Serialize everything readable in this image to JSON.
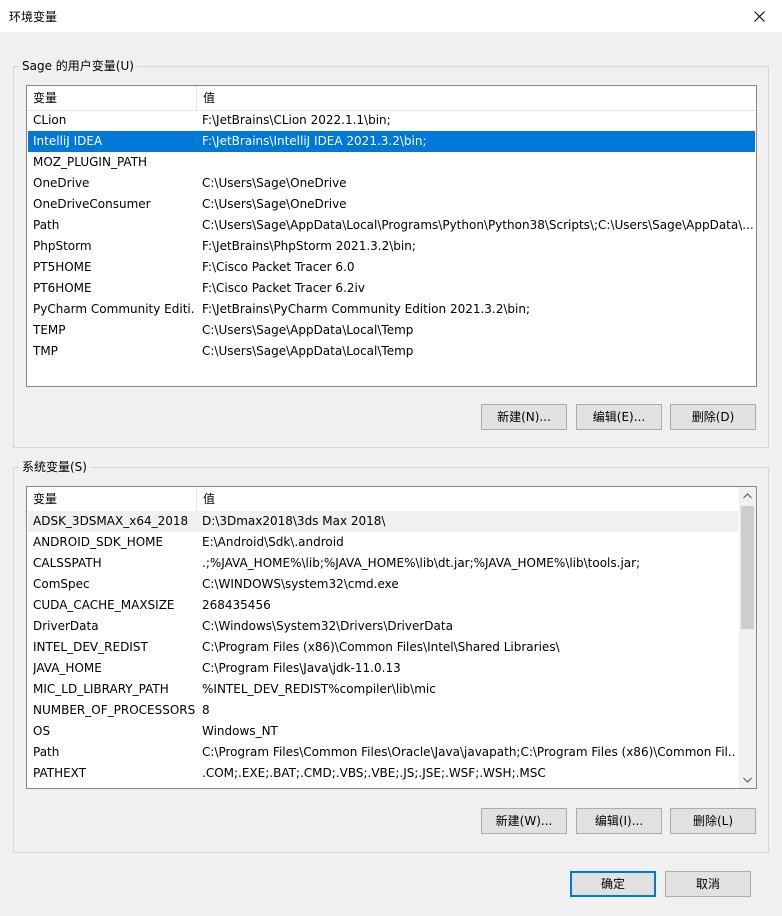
{
  "window": {
    "title": "环境变量",
    "close_icon": "close-icon"
  },
  "user_vars": {
    "group_label": "Sage 的用户变量(U)",
    "columns": [
      "变量",
      "值"
    ],
    "rows": [
      {
        "name": "CLion",
        "value": "F:\\JetBrains\\CLion 2022.1.1\\bin;"
      },
      {
        "name": "IntelliJ IDEA",
        "value": "F:\\JetBrains\\IntelliJ IDEA 2021.3.2\\bin;",
        "selected": true
      },
      {
        "name": "MOZ_PLUGIN_PATH",
        "value": ""
      },
      {
        "name": "OneDrive",
        "value": "C:\\Users\\Sage\\OneDrive"
      },
      {
        "name": "OneDriveConsumer",
        "value": "C:\\Users\\Sage\\OneDrive"
      },
      {
        "name": "Path",
        "value": "C:\\Users\\Sage\\AppData\\Local\\Programs\\Python\\Python38\\Scripts\\;C:\\Users\\Sage\\AppData\\..."
      },
      {
        "name": "PhpStorm",
        "value": "F:\\JetBrains\\PhpStorm 2021.3.2\\bin;"
      },
      {
        "name": "PT5HOME",
        "value": "F:\\Cisco Packet Tracer 6.0"
      },
      {
        "name": "PT6HOME",
        "value": "F:\\Cisco Packet Tracer 6.2iv"
      },
      {
        "name": "PyCharm Community Editi...",
        "value": "F:\\JetBrains\\PyCharm Community Edition 2021.3.2\\bin;"
      },
      {
        "name": "TEMP",
        "value": "C:\\Users\\Sage\\AppData\\Local\\Temp"
      },
      {
        "name": "TMP",
        "value": "C:\\Users\\Sage\\AppData\\Local\\Temp"
      }
    ],
    "buttons": {
      "new": "新建(N)...",
      "edit": "编辑(E)...",
      "delete": "删除(D)"
    }
  },
  "system_vars": {
    "group_label": "系统变量(S)",
    "columns": [
      "变量",
      "值"
    ],
    "rows": [
      {
        "name": "ADSK_3DSMAX_x64_2018",
        "value": "D:\\3Dmax2018\\3ds Max 2018\\",
        "highlighted": true
      },
      {
        "name": "ANDROID_SDK_HOME",
        "value": "E:\\Android\\Sdk\\.android"
      },
      {
        "name": "CALSSPATH",
        "value": ".;%JAVA_HOME%\\lib;%JAVA_HOME%\\lib\\dt.jar;%JAVA_HOME%\\lib\\tools.jar;"
      },
      {
        "name": "ComSpec",
        "value": "C:\\WINDOWS\\system32\\cmd.exe"
      },
      {
        "name": "CUDA_CACHE_MAXSIZE",
        "value": "268435456"
      },
      {
        "name": "DriverData",
        "value": "C:\\Windows\\System32\\Drivers\\DriverData"
      },
      {
        "name": "INTEL_DEV_REDIST",
        "value": "C:\\Program Files (x86)\\Common Files\\Intel\\Shared Libraries\\"
      },
      {
        "name": "JAVA_HOME",
        "value": "C:\\Program Files\\Java\\jdk-11.0.13"
      },
      {
        "name": "MIC_LD_LIBRARY_PATH",
        "value": "%INTEL_DEV_REDIST%compiler\\lib\\mic"
      },
      {
        "name": "NUMBER_OF_PROCESSORS",
        "value": "8"
      },
      {
        "name": "OS",
        "value": "Windows_NT"
      },
      {
        "name": "Path",
        "value": "C:\\Program Files\\Common Files\\Oracle\\Java\\javapath;C:\\Program Files (x86)\\Common Fil..."
      },
      {
        "name": "PATHEXT",
        "value": ".COM;.EXE;.BAT;.CMD;.VBS;.VBE;.JS;.JSE;.WSF;.WSH;.MSC"
      }
    ],
    "buttons": {
      "new": "新建(W)...",
      "edit": "编辑(I)...",
      "delete": "删除(L)"
    }
  },
  "dialog_buttons": {
    "ok": "确定",
    "cancel": "取消"
  },
  "colors": {
    "selection": "#0078d7",
    "default_button_border": "#0078d7"
  }
}
